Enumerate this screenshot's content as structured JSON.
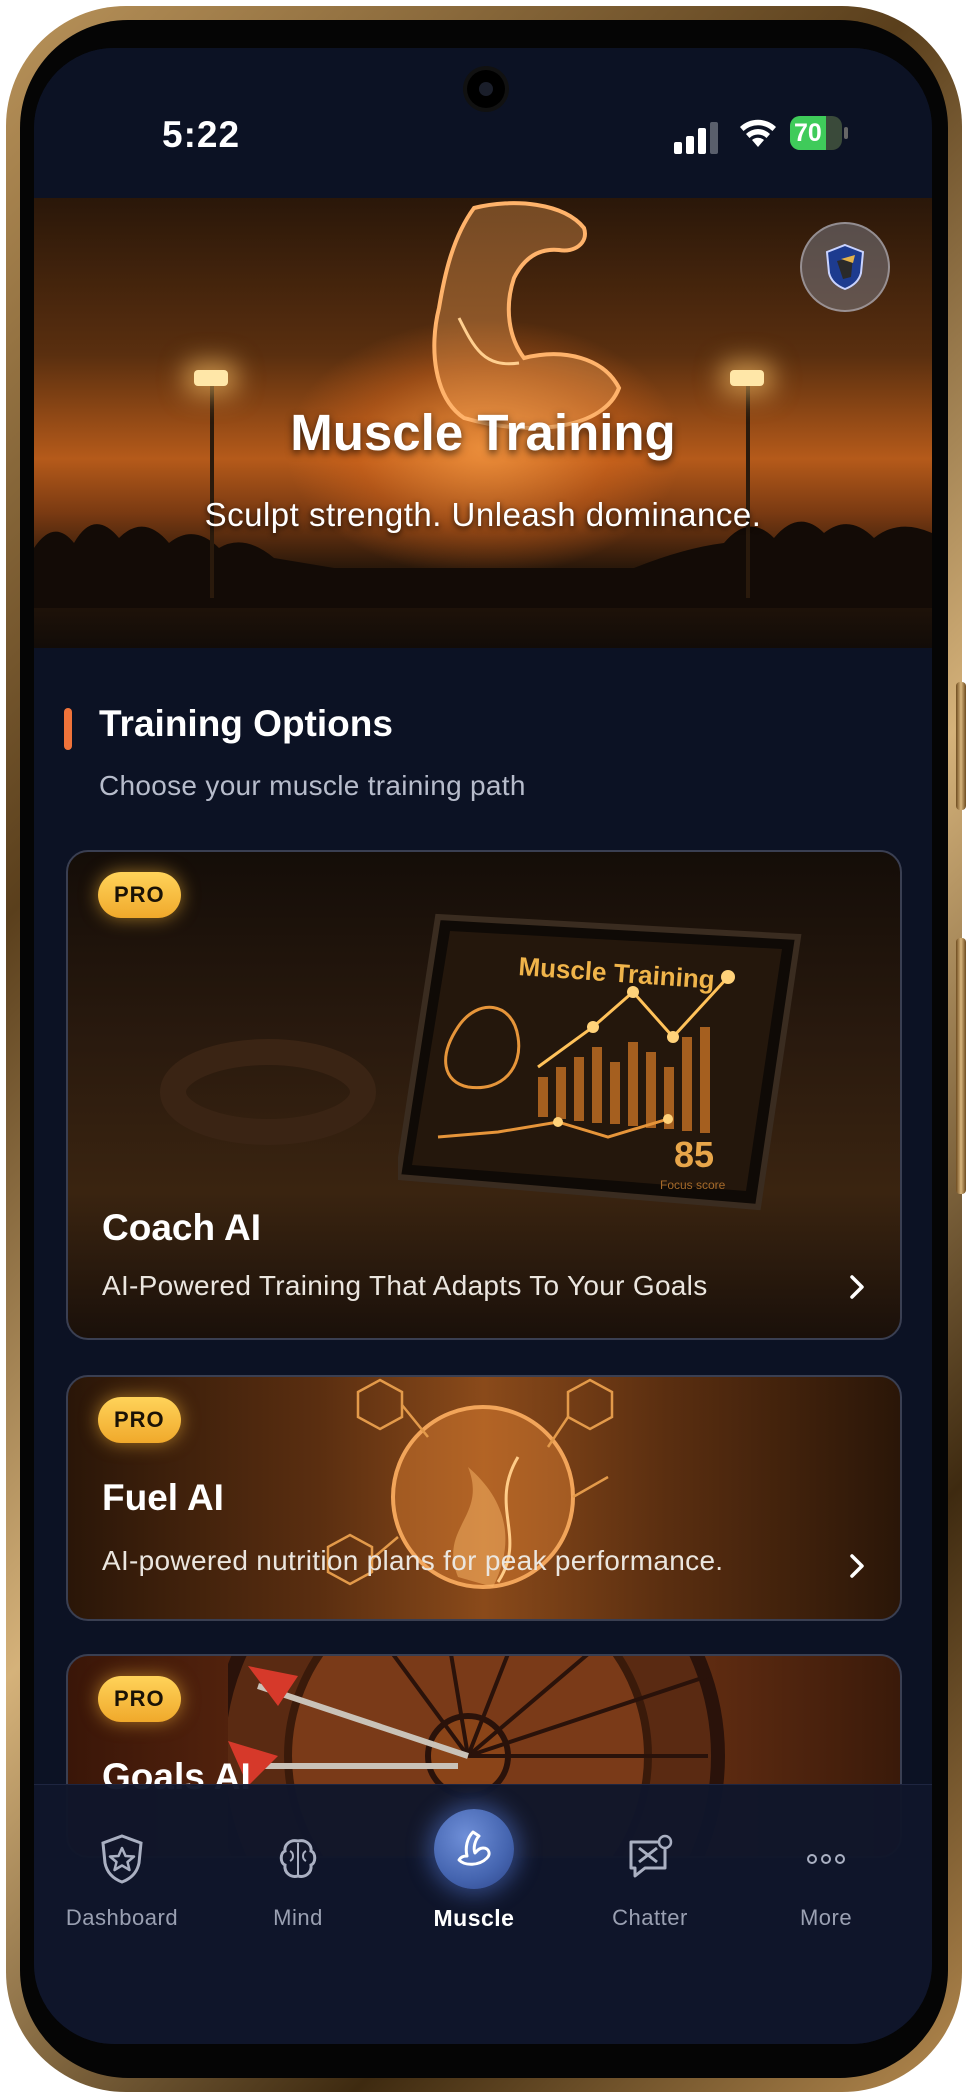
{
  "status_bar": {
    "time": "5:22",
    "battery": "70",
    "battery_level": 0.7,
    "battery_color": "#3fcb5a"
  },
  "hero": {
    "title": "Muscle Training",
    "subtitle": "Sculpt strength. Unleash dominance.",
    "badge_icon": "shield-badge-icon"
  },
  "section": {
    "title": "Training Options",
    "subtitle": "Choose your muscle training path",
    "accent_color": "#f0733a"
  },
  "cards": [
    {
      "badge": "PRO",
      "title": "Coach AI",
      "description": "AI-Powered Training That Adapts To Your Goals",
      "screen_title": "Muscle Training",
      "screen_score": "85",
      "screen_caption": "Focus score"
    },
    {
      "badge": "PRO",
      "title": "Fuel AI",
      "description": "AI-powered nutrition plans for peak performance."
    },
    {
      "badge": "PRO",
      "title": "Goals AI"
    }
  ],
  "tab_bar": {
    "tabs": [
      {
        "label": "Dashboard",
        "icon": "shield-star-icon"
      },
      {
        "label": "Mind",
        "icon": "brain-icon"
      },
      {
        "label": "Muscle",
        "icon": "flexed-arm-icon"
      },
      {
        "label": "Chatter",
        "icon": "chat-swords-icon"
      },
      {
        "label": "More",
        "icon": "more-dots-icon"
      }
    ],
    "active_index": 2,
    "active_color": "#4565b0"
  }
}
